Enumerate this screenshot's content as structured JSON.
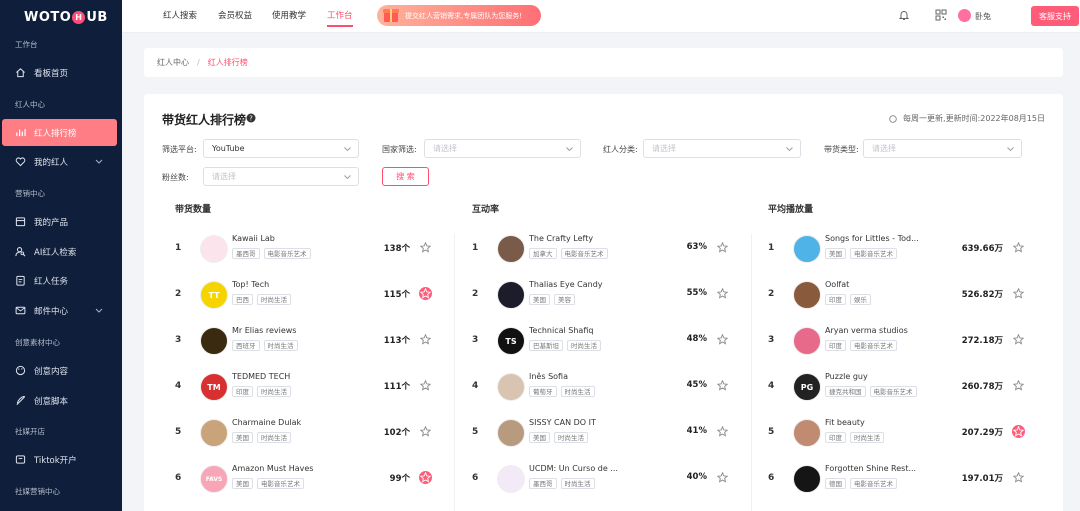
{
  "app": {
    "logo_text_a": "WOTO",
    "logo_badge": "H",
    "logo_text_b": "UB"
  },
  "sidebar": {
    "sections": [
      {
        "label": "工作台"
      },
      {
        "label": "红人中心"
      },
      {
        "label": "营销中心"
      },
      {
        "label": "创意素材中心"
      },
      {
        "label": "社媒开店"
      },
      {
        "label": "社媒营销中心"
      }
    ],
    "items": [
      {
        "label": "看板首页",
        "icon": "home-icon"
      },
      {
        "label": "红人排行榜",
        "icon": "bar-chart-icon",
        "active": true
      },
      {
        "label": "我的红人",
        "icon": "heart-icon",
        "expandable": true
      },
      {
        "label": "我的产品",
        "icon": "box-icon"
      },
      {
        "label": "AI红人检索",
        "icon": "user-search-icon"
      },
      {
        "label": "红人任务",
        "icon": "task-icon"
      },
      {
        "label": "邮件中心",
        "icon": "mail-icon",
        "expandable": true
      },
      {
        "label": "创意内容",
        "icon": "palette-icon"
      },
      {
        "label": "创意脚本",
        "icon": "feather-icon"
      },
      {
        "label": "Tiktok开户",
        "icon": "tiktok-icon"
      }
    ]
  },
  "topnav": {
    "tabs": [
      {
        "label": "红人搜索"
      },
      {
        "label": "会员权益"
      },
      {
        "label": "使用教学"
      },
      {
        "label": "工作台",
        "active": true
      }
    ],
    "banner_text": "提交红人营销需求,专属团队为您服务!",
    "username": "卧兔",
    "support_label": "客服支持"
  },
  "breadcrumb": {
    "root": "红人中心",
    "separator": "/",
    "current": "红人排行榜"
  },
  "main": {
    "title": "带货红人排行榜",
    "update_info": "每周一更新,更新时间:2022年08月15日",
    "filters": {
      "platform_label": "筛选平台:",
      "platform_value": "YouTube",
      "country_label": "国家筛选:",
      "country_placeholder": "请选择",
      "category_label": "红人分类:",
      "category_placeholder": "请选择",
      "goods_label": "带货类型:",
      "goods_placeholder": "请选择",
      "fans_label": "粉丝数:",
      "fans_placeholder": "请选择",
      "search_label": "搜 索"
    },
    "columns": [
      {
        "title": "带货数量",
        "rows": [
          {
            "rank": "1",
            "name": "Kawaii Lab",
            "tags": [
              "墨西哥",
              "电影音乐艺术"
            ],
            "value": "138个",
            "starred": false,
            "avatar_color": "#fce4ec",
            "avatar_text": ""
          },
          {
            "rank": "2",
            "name": "Top! Tech",
            "tags": [
              "巴西",
              "时尚生活"
            ],
            "value": "115个",
            "starred": true,
            "avatar_color": "#f5d400",
            "avatar_text": "TT"
          },
          {
            "rank": "3",
            "name": "Mr Elias reviews",
            "tags": [
              "西班牙",
              "时尚生活"
            ],
            "value": "113个",
            "starred": false,
            "avatar_color": "#3a2b10",
            "avatar_text": ""
          },
          {
            "rank": "4",
            "name": "TEDMED TECH",
            "tags": [
              "印度",
              "时尚生活"
            ],
            "value": "111个",
            "starred": false,
            "avatar_color": "#d83030",
            "avatar_text": "TM"
          },
          {
            "rank": "5",
            "name": "Charmaine Dulak",
            "tags": [
              "美国",
              "时尚生活"
            ],
            "value": "102个",
            "starred": false,
            "avatar_color": "#c9a47a",
            "avatar_text": ""
          },
          {
            "rank": "6",
            "name": "Amazon Must Haves",
            "tags": [
              "美国",
              "电影音乐艺术"
            ],
            "value": "99个",
            "starred": true,
            "avatar_color": "#f7a6b8",
            "avatar_text": "FAVS"
          }
        ]
      },
      {
        "title": "互动率",
        "rows": [
          {
            "rank": "1",
            "name": "The Crafty Lefty",
            "tags": [
              "加拿大",
              "电影音乐艺术"
            ],
            "value": "63%",
            "starred": false,
            "avatar_color": "#7a5a48",
            "avatar_text": ""
          },
          {
            "rank": "2",
            "name": "Thalias Eye Candy",
            "tags": [
              "美国",
              "美容"
            ],
            "value": "55%",
            "starred": false,
            "avatar_color": "#1c1c2a",
            "avatar_text": ""
          },
          {
            "rank": "3",
            "name": "Technical Shafiq",
            "tags": [
              "巴基斯坦",
              "时尚生活"
            ],
            "value": "48%",
            "starred": false,
            "avatar_color": "#111111",
            "avatar_text": "TS"
          },
          {
            "rank": "4",
            "name": "Inês Sofia",
            "tags": [
              "葡萄牙",
              "时尚生活"
            ],
            "value": "45%",
            "starred": false,
            "avatar_color": "#d8c4b0",
            "avatar_text": ""
          },
          {
            "rank": "5",
            "name": "SISSY CAN DO IT",
            "tags": [
              "美国",
              "时尚生活"
            ],
            "value": "41%",
            "starred": false,
            "avatar_color": "#b89a7e",
            "avatar_text": ""
          },
          {
            "rank": "6",
            "name": "UCDM: Un Curso de ...",
            "tags": [
              "墨西哥",
              "时尚生活"
            ],
            "value": "40%",
            "starred": false,
            "avatar_color": "#f3e9f7",
            "avatar_text": ""
          }
        ]
      },
      {
        "title": "平均播放量",
        "rows": [
          {
            "rank": "1",
            "name": "Songs for Littles - Tod...",
            "tags": [
              "美国",
              "电影音乐艺术"
            ],
            "value": "639.66万",
            "starred": false,
            "avatar_color": "#4fb3e8",
            "avatar_text": ""
          },
          {
            "rank": "2",
            "name": "Oolfat",
            "tags": [
              "印度",
              "娱乐"
            ],
            "value": "526.82万",
            "starred": false,
            "avatar_color": "#8a5a3c",
            "avatar_text": ""
          },
          {
            "rank": "3",
            "name": "Aryan verma studios",
            "tags": [
              "印度",
              "电影音乐艺术"
            ],
            "value": "272.18万",
            "starred": false,
            "avatar_color": "#e86a8a",
            "avatar_text": ""
          },
          {
            "rank": "4",
            "name": "Puzzle guy",
            "tags": [
              "捷克共和国",
              "电影音乐艺术"
            ],
            "value": "260.78万",
            "starred": false,
            "avatar_color": "#222222",
            "avatar_text": "PG"
          },
          {
            "rank": "5",
            "name": "Fit beauty",
            "tags": [
              "印度",
              "时尚生活"
            ],
            "value": "207.29万",
            "starred": true,
            "avatar_color": "#c08b70",
            "avatar_text": ""
          },
          {
            "rank": "6",
            "name": "Forgotten Shine Rest...",
            "tags": [
              "德国",
              "电影音乐艺术"
            ],
            "value": "197.01万",
            "starred": false,
            "avatar_color": "#151515",
            "avatar_text": ""
          }
        ]
      }
    ]
  },
  "colors": {
    "accent": "#ff4d6d",
    "sidebar_bg": "#0f1e3a",
    "active_item": "#ff7d84"
  }
}
